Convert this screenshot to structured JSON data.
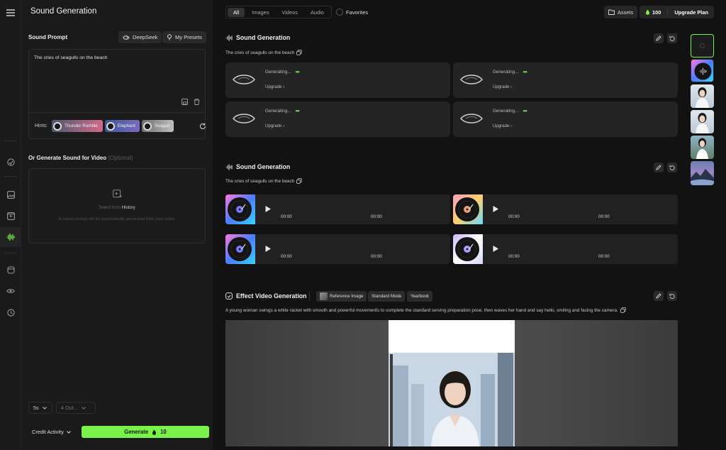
{
  "app": {
    "title": "Sound Generation"
  },
  "left_panel": {
    "sound_prompt_label": "Sound Prompt",
    "deepseek_label": "DeepSeek",
    "presets_label": "My Presets",
    "prompt_value": "The cries of seagulls on the beach",
    "hints_label": "Hints:",
    "hints": [
      "Thunder Rumble",
      "Elephant",
      "Seagull"
    ],
    "video_label": "Or Generate Sound for Video",
    "video_optional": "(Optional)",
    "select_from": "Select from",
    "history": "History",
    "video_help": "A sound prompt will be automatically generated from your video.",
    "duration": "5s",
    "outputs": "4 Out...",
    "credit_activity": "Credit Activity",
    "generate_label": "Generate",
    "generate_cost": "10"
  },
  "topbar": {
    "tabs": [
      "All",
      "Images",
      "Videos",
      "Audio"
    ],
    "active_tab": "All",
    "favorites": "Favorites",
    "assets": "Assets",
    "credits": "100",
    "upgrade": "Upgrade Plan"
  },
  "sections": [
    {
      "title": "Sound Generation",
      "prompt": "The cries of seagulls on the beach",
      "cards": [
        {
          "status": "Generating...",
          "upgrade": "Upgrade"
        },
        {
          "status": "Generating...",
          "upgrade": "Upgrade"
        },
        {
          "status": "Generating...",
          "upgrade": "Upgrade"
        },
        {
          "status": "Generating...",
          "upgrade": "Upgrade"
        }
      ]
    },
    {
      "title": "Sound Generation",
      "prompt": "The cries of seagulls on the beach",
      "tracks": [
        {
          "elapsed": "00:00",
          "duration": "00:00"
        },
        {
          "elapsed": "00:00",
          "duration": "00:00"
        },
        {
          "elapsed": "00:00",
          "duration": "00:00"
        },
        {
          "elapsed": "00:00",
          "duration": "00:00"
        }
      ]
    },
    {
      "title": "Effect Video Generation",
      "chips": [
        "Reference Image",
        "Standard Mode",
        "Yearbook"
      ],
      "prompt": "A young woman swings a white racket with smooth and powerful movements to complete the standard serving preparation pose, then waves her hand and say hello, smiling and facing the camera."
    }
  ],
  "colors": {
    "accent": "#7bf24a",
    "background": "#121212",
    "panel": "#1a1a1a"
  },
  "icons": [
    "menu-icon",
    "deepseek-icon",
    "pin-icon",
    "save-icon",
    "trash-icon",
    "refresh-icon",
    "add-video-icon",
    "audio-wave-icon",
    "edit-icon",
    "undo-icon",
    "copy-icon",
    "play-icon",
    "folder-icon",
    "coin-icon",
    "lens-icon"
  ]
}
